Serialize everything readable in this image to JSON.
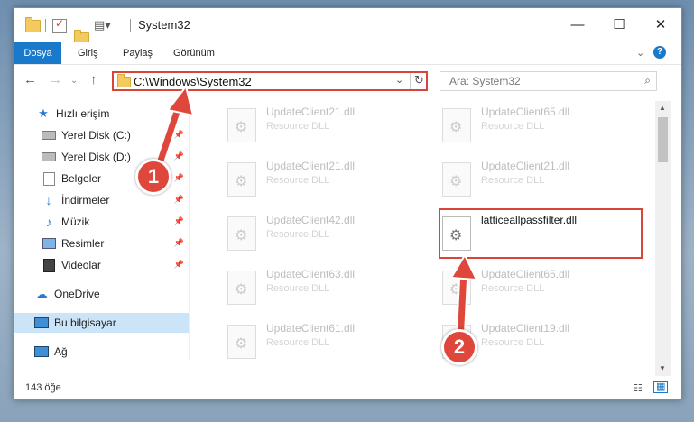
{
  "window": {
    "title": "System32"
  },
  "ribbon": {
    "tabs": [
      "Dosya",
      "Giriş",
      "Paylaş",
      "Görünüm"
    ]
  },
  "address": {
    "path": "C:\\Windows\\System32",
    "search_placeholder": "Ara: System32"
  },
  "sidebar": {
    "items": [
      {
        "label": "Hızlı erişim",
        "icon": "star-icon"
      },
      {
        "label": "Yerel Disk (C:)",
        "icon": "drive-icon"
      },
      {
        "label": "Yerel Disk (D:)",
        "icon": "drive-icon"
      },
      {
        "label": "Belgeler",
        "icon": "documents-icon"
      },
      {
        "label": "İndirmeler",
        "icon": "download-icon"
      },
      {
        "label": "Müzik",
        "icon": "music-icon"
      },
      {
        "label": "Resimler",
        "icon": "pictures-icon"
      },
      {
        "label": "Videolar",
        "icon": "video-icon"
      },
      {
        "label": "OneDrive",
        "icon": "cloud-icon"
      },
      {
        "label": "Bu bilgisayar",
        "icon": "computer-icon"
      },
      {
        "label": "Ağ",
        "icon": "network-icon"
      }
    ]
  },
  "files": [
    {
      "name": "UpdateClient21.dll",
      "type": "Resource DLL"
    },
    {
      "name": "UpdateClient65.dll",
      "type": "Resource DLL"
    },
    {
      "name": "UpdateClient21.dll",
      "type": "Resource DLL"
    },
    {
      "name": "UpdateClient21.dll",
      "type": "Resource DLL"
    },
    {
      "name": "UpdateClient42.dll",
      "type": "Resource DLL"
    },
    {
      "name": "latticeallpassfilter.dll",
      "type": ""
    },
    {
      "name": "UpdateClient63.dll",
      "type": "Resource DLL"
    },
    {
      "name": "UpdateClient65.dll",
      "type": "Resource DLL"
    },
    {
      "name": "UpdateClient61.dll",
      "type": "Resource DLL"
    },
    {
      "name": "UpdateClient19.dll",
      "type": "Resource DLL"
    }
  ],
  "status": {
    "count": "143 öğe"
  },
  "annotations": {
    "step1": "1",
    "step2": "2"
  },
  "colors": {
    "accent": "#1979ca",
    "highlight": "#d9453a",
    "selected": "#cce4f7"
  }
}
